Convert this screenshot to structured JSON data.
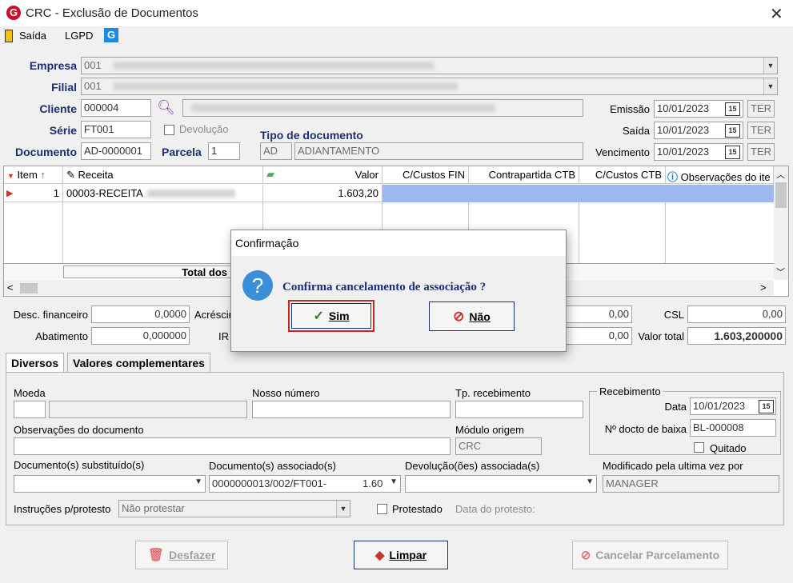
{
  "window": {
    "title": "CRC - Exclusão de Documentos",
    "app_logo": "G"
  },
  "menu": {
    "saida": "Saída",
    "lgpd": "LGPD",
    "g_logo": "G"
  },
  "header": {
    "empresa_label": "Empresa",
    "empresa_value": "001",
    "filial_label": "Filial",
    "filial_value": "001",
    "cliente_label": "Cliente",
    "cliente_value": "000004",
    "serie_label": "Série",
    "serie_value": "FT001",
    "devolucao_label": "Devolução",
    "documento_label": "Documento",
    "documento_value": "AD-0000001",
    "parcela_label": "Parcela",
    "parcela_value": "1",
    "tipo_doc_label": "Tipo de documento",
    "tipo_doc_code": "AD",
    "tipo_doc_desc": "ADIANTAMENTO",
    "emissao_label": "Emissão",
    "emissao_value": "10/01/2023",
    "emissao_day": "TER",
    "saida_label": "Saída",
    "saida_value": "10/01/2023",
    "saida_day": "TER",
    "vencimento_label": "Vencimento",
    "vencimento_value": "10/01/2023",
    "vencimento_day": "TER",
    "calendar_glyph": "15"
  },
  "grid": {
    "columns": {
      "item": "Item",
      "receita": "Receita",
      "valor": "Valor",
      "ccustos_fin": "C/Custos FIN",
      "contrapartida": "Contrapartida CTB",
      "ccustos_ctb": "C/Custos CTB",
      "observacoes": "Observações do ite"
    },
    "row": {
      "item": "1",
      "receita": "00003-RECEITA",
      "valor": "1.603,20"
    },
    "total_label": "Total dos"
  },
  "totals": {
    "desc_fin_label": "Desc. financeiro",
    "desc_fin_value": "0,0000",
    "acresc_label": "Acréscin",
    "abatimento_label": "Abatimento",
    "abatimento_value": "0,000000",
    "ir_label": "IR",
    "val_a": "0,00",
    "val_b": "0,00",
    "csl_label": "CSL",
    "csl_value": "0,00",
    "valor_total_label": "Valor total",
    "valor_total_value": "1.603,200000"
  },
  "tabs": {
    "diversos": "Diversos",
    "valores": "Valores complementares"
  },
  "diversos": {
    "moeda_label": "Moeda",
    "nosso_numero_label": "Nosso número",
    "tp_recebimento_label": "Tp. recebimento",
    "recebimento_label": "Recebimento",
    "data_label": "Data",
    "data_value": "10/01/2023",
    "n_docto_baixa_label": "Nº docto de baixa",
    "n_docto_baixa_value": "BL-000008",
    "quitado_label": "Quitado",
    "obs_label": "Observações do documento",
    "modulo_origem_label": "Módulo origem",
    "modulo_origem_value": "CRC",
    "doc_subst_label": "Documento(s) substituído(s)",
    "doc_assoc_label": "Documento(s) associado(s)",
    "doc_assoc_value": "0000000013/002/FT001-",
    "doc_assoc_amount": "1.60",
    "devolucao_assoc_label": "Devolução(ões) associada(s)",
    "modificado_label": "Modificado pela ultima vez por",
    "modificado_value": "MANAGER",
    "instrucoes_label": "Instruções p/protesto",
    "instrucoes_value": "Não protestar",
    "protestado_label": "Protestado",
    "data_protesto_label": "Data do protesto:"
  },
  "buttons": {
    "desfazer": "Desfazer",
    "limpar": "Limpar",
    "cancelar_parcelamento": "Cancelar Parcelamento"
  },
  "dialog": {
    "title": "Confirmação",
    "message": "Confirma cancelamento de associação ?",
    "sim": "Sim",
    "nao": "Não",
    "question_glyph": "?"
  },
  "colors": {
    "label_blue": "#1c2e73",
    "selection": "#9db9f0",
    "dialog_focus": "#c62828"
  }
}
